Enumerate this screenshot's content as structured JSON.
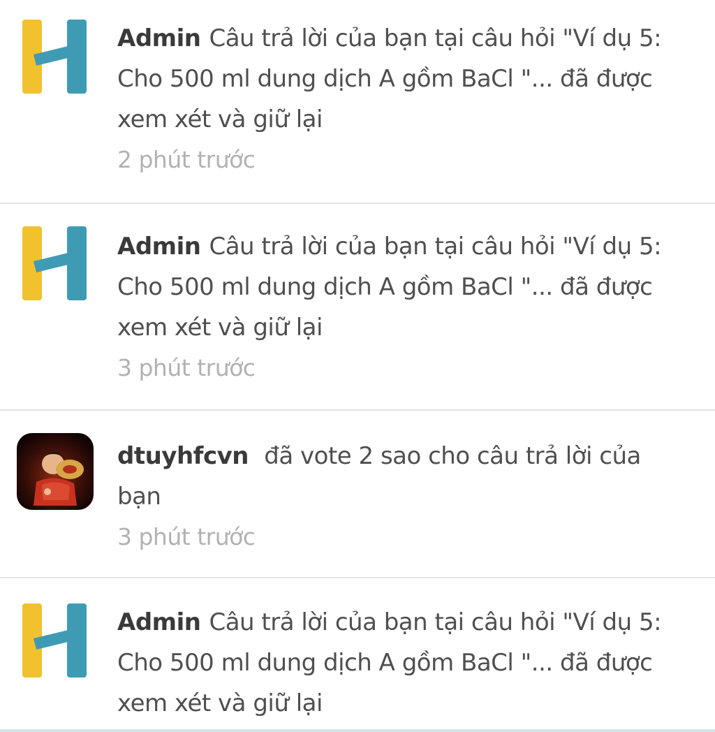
{
  "notifications": [
    {
      "avatar": "hoc24-logo-icon",
      "user": "Admin",
      "message": "Câu trả lời của bạn tại câu hỏi \"Ví dụ 5: Cho 500 ml dung dịch A gồm BaCl \"... đã được xem xét và giữ lại",
      "time": "2 phút trước"
    },
    {
      "avatar": "hoc24-logo-icon",
      "user": "Admin",
      "message": "Câu trả lời của bạn tại câu hỏi \"Ví dụ 5: Cho 500 ml dung dịch A gồm BaCl \"... đã được xem xét và giữ lại",
      "time": "3 phút trước"
    },
    {
      "avatar": "user-avatar-photo",
      "user": "dtuyhfcvn",
      "message": "đã vote 2 sao cho câu trả lời của bạn",
      "time": "3 phút trước"
    },
    {
      "avatar": "hoc24-logo-icon",
      "user": "Admin",
      "message": "Câu trả lời của bạn tại câu hỏi \"Ví dụ 5: Cho 500 ml dung dịch A gồm BaCl \"... đã được xem xét và giữ lại",
      "time": ""
    }
  ],
  "colors": {
    "logo_yellow": "#f2c12e",
    "logo_blue": "#3f9bb4",
    "name_text": "#3a3a3a",
    "message_text": "#4f4f4f",
    "time_text": "#b2b2b2",
    "divider": "#e2e2e2"
  }
}
